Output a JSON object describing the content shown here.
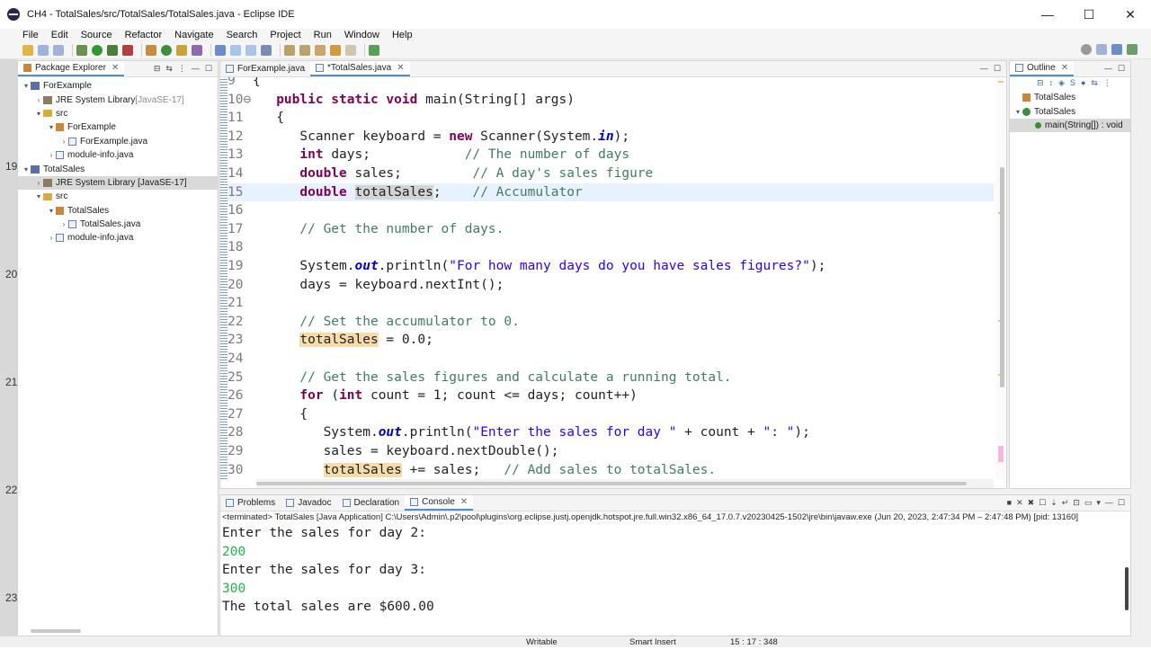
{
  "window": {
    "title": "CH4 - TotalSales/src/TotalSales/TotalSales.java - Eclipse IDE",
    "controls": {
      "minimize": "—",
      "maximize": "☐",
      "close": "✕"
    }
  },
  "menu": [
    "File",
    "Edit",
    "Source",
    "Refactor",
    "Navigate",
    "Search",
    "Project",
    "Run",
    "Window",
    "Help"
  ],
  "left_strip_ticks": [
    "19",
    "20",
    "21",
    "22",
    "23"
  ],
  "package_explorer": {
    "tab_label": "Package Explorer",
    "tree": [
      {
        "label": "ForExample",
        "suffix": "",
        "icon": "project-icon",
        "level": 0,
        "arrow": "▾"
      },
      {
        "label": "JRE System Library",
        "suffix": " [JavaSE-17]",
        "icon": "library-icon",
        "level": 1,
        "arrow": "›"
      },
      {
        "label": "src",
        "suffix": "",
        "icon": "folder-icon",
        "level": 1,
        "arrow": "▾"
      },
      {
        "label": "ForExample",
        "suffix": "",
        "icon": "package-icon",
        "level": 2,
        "arrow": "▾"
      },
      {
        "label": "ForExample.java",
        "suffix": "",
        "icon": "java-file-icon",
        "level": 3,
        "arrow": "›"
      },
      {
        "label": "module-info.java",
        "suffix": "",
        "icon": "java-file-icon",
        "level": 2,
        "arrow": "›"
      },
      {
        "label": "TotalSales",
        "suffix": "",
        "icon": "project-icon",
        "level": 0,
        "arrow": "▾"
      },
      {
        "label": "JRE System Library [JavaSE-17]",
        "suffix": "",
        "icon": "library-icon",
        "level": 1,
        "arrow": "›",
        "selected": true
      },
      {
        "label": "src",
        "suffix": "",
        "icon": "folder-icon",
        "level": 1,
        "arrow": "▾"
      },
      {
        "label": "TotalSales",
        "suffix": "",
        "icon": "package-icon",
        "level": 2,
        "arrow": "▾"
      },
      {
        "label": "TotalSales.java",
        "suffix": "",
        "icon": "java-file-icon",
        "level": 3,
        "arrow": "›"
      },
      {
        "label": "module-info.java",
        "suffix": "",
        "icon": "java-file-icon",
        "level": 2,
        "arrow": "›"
      }
    ]
  },
  "editor": {
    "tabs": [
      {
        "label": "ForExample.java",
        "active": false
      },
      {
        "label": "*TotalSales.java",
        "active": true
      }
    ],
    "lines": [
      {
        "n": "9",
        "parts": [
          [
            "p",
            "{"
          ]
        ]
      },
      {
        "n": "10⊖",
        "parts": [
          [
            "p",
            "   "
          ],
          [
            "kw",
            "public static void"
          ],
          [
            "p",
            " main(String[] args)"
          ]
        ]
      },
      {
        "n": "11",
        "parts": [
          [
            "p",
            "   {"
          ]
        ]
      },
      {
        "n": "12",
        "parts": [
          [
            "p",
            "      Scanner keyboard = "
          ],
          [
            "kw",
            "new"
          ],
          [
            "p",
            " Scanner(System."
          ],
          [
            "fld",
            "in"
          ],
          [
            "p",
            ");"
          ]
        ]
      },
      {
        "n": "13",
        "parts": [
          [
            "p",
            "      "
          ],
          [
            "kw",
            "int"
          ],
          [
            "p",
            " days;            "
          ],
          [
            "cm",
            "// The number of days"
          ]
        ]
      },
      {
        "n": "14",
        "parts": [
          [
            "p",
            "      "
          ],
          [
            "kw",
            "double"
          ],
          [
            "p",
            " sales;         "
          ],
          [
            "cm",
            "// A day's sales figure"
          ]
        ]
      },
      {
        "n": "15",
        "current": true,
        "parts": [
          [
            "p",
            "      "
          ],
          [
            "kw",
            "double"
          ],
          [
            "p",
            " "
          ],
          [
            "hl2",
            "totalSales"
          ],
          [
            "p",
            ";    "
          ],
          [
            "cm",
            "// Accumulator"
          ]
        ]
      },
      {
        "n": "16",
        "parts": [
          [
            "p",
            ""
          ]
        ]
      },
      {
        "n": "17",
        "parts": [
          [
            "p",
            "      "
          ],
          [
            "cm",
            "// Get the number of days."
          ]
        ]
      },
      {
        "n": "18",
        "parts": [
          [
            "p",
            ""
          ]
        ]
      },
      {
        "n": "19",
        "parts": [
          [
            "p",
            "      System."
          ],
          [
            "fld",
            "out"
          ],
          [
            "p",
            ".println("
          ],
          [
            "str",
            "\"For how many days do you have sales figures?\""
          ],
          [
            "p",
            ");"
          ]
        ]
      },
      {
        "n": "20",
        "parts": [
          [
            "p",
            "      days = keyboard.nextInt();"
          ]
        ]
      },
      {
        "n": "21",
        "parts": [
          [
            "p",
            ""
          ]
        ]
      },
      {
        "n": "22",
        "parts": [
          [
            "p",
            "      "
          ],
          [
            "cm",
            "// Set the accumulator to 0."
          ]
        ]
      },
      {
        "n": "23",
        "parts": [
          [
            "p",
            "      "
          ],
          [
            "hl",
            "totalSales"
          ],
          [
            "p",
            " = 0.0;"
          ]
        ]
      },
      {
        "n": "24",
        "parts": [
          [
            "p",
            ""
          ]
        ]
      },
      {
        "n": "25",
        "parts": [
          [
            "p",
            "      "
          ],
          [
            "cm",
            "// Get the sales figures and calculate a running total."
          ]
        ]
      },
      {
        "n": "26",
        "parts": [
          [
            "p",
            "      "
          ],
          [
            "kw",
            "for"
          ],
          [
            "p",
            " ("
          ],
          [
            "kw",
            "int"
          ],
          [
            "p",
            " count = 1; count <= days; count++)"
          ]
        ]
      },
      {
        "n": "27",
        "parts": [
          [
            "p",
            "      {"
          ]
        ]
      },
      {
        "n": "28",
        "parts": [
          [
            "p",
            "         System."
          ],
          [
            "fld",
            "out"
          ],
          [
            "p",
            ".println("
          ],
          [
            "str",
            "\"Enter the sales for day \""
          ],
          [
            "p",
            " + count + "
          ],
          [
            "str",
            "\": \""
          ],
          [
            "p",
            ");"
          ]
        ]
      },
      {
        "n": "29",
        "parts": [
          [
            "p",
            "         sales = keyboard.nextDouble();"
          ]
        ]
      },
      {
        "n": "30",
        "parts": [
          [
            "p",
            "         "
          ],
          [
            "hl",
            "totalSales"
          ],
          [
            "p",
            " += sales;   "
          ],
          [
            "cm",
            "// Add sales to totalSales."
          ]
        ]
      }
    ]
  },
  "outline": {
    "tab_label": "Outline",
    "tree": [
      {
        "label": "TotalSales",
        "icon": "package-icon",
        "level": 0,
        "arrow": ""
      },
      {
        "label": "TotalSales",
        "icon": "class-icon",
        "level": 0,
        "arrow": "▾"
      },
      {
        "label": "main(String[]) : void",
        "icon": "method-icon",
        "level": 1,
        "arrow": "",
        "selected": true
      }
    ]
  },
  "bottom": {
    "tabs": [
      {
        "label": "Problems",
        "active": false
      },
      {
        "label": "Javadoc",
        "active": false
      },
      {
        "label": "Declaration",
        "active": false
      },
      {
        "label": "Console",
        "active": true
      }
    ],
    "console_header": "<terminated> TotalSales [Java Application] C:\\Users\\Admin\\.p2\\pool\\plugins\\org.eclipse.justj.openjdk.hotspot.jre.full.win32.x86_64_17.0.7.v20230425-1502\\jre\\bin\\javaw.exe  (Jun 20, 2023, 2:47:34 PM – 2:47:48 PM) [pid: 13160]",
    "console_lines": [
      {
        "text": "Enter the sales for day 2:",
        "input": false
      },
      {
        "text": "200",
        "input": true
      },
      {
        "text": "Enter the sales for day 3:",
        "input": false
      },
      {
        "text": "300",
        "input": true
      },
      {
        "text": "The total sales are $600.00",
        "input": false
      }
    ]
  },
  "status": {
    "writable": "Writable",
    "insert_mode": "Smart Insert",
    "position": "15 : 17 : 348"
  },
  "colors": {
    "keyword": "#7f0055",
    "comment": "#3f7f5f",
    "string": "#2a00ff",
    "field": "#0000c0",
    "occurrence_highlight": "#f7dba8",
    "console_input": "#24b24e"
  }
}
